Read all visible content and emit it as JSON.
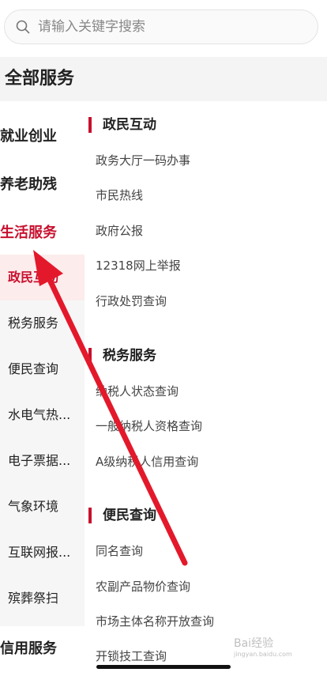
{
  "search": {
    "placeholder": "请输入关键字搜索"
  },
  "section_title": "全部服务",
  "categories": [
    {
      "label": "就业创业",
      "active": false
    },
    {
      "label": "养老助残",
      "active": false
    },
    {
      "label": "生活服务",
      "active": true
    },
    {
      "label": "信用服务",
      "active": false
    }
  ],
  "sub_categories": [
    {
      "label": "政民互动",
      "active": true
    },
    {
      "label": "税务服务",
      "active": false
    },
    {
      "label": "便民查询",
      "active": false
    },
    {
      "label": "水电气热...",
      "active": false
    },
    {
      "label": "电子票据...",
      "active": false
    },
    {
      "label": "气象环境",
      "active": false
    },
    {
      "label": "互联网报...",
      "active": false
    },
    {
      "label": "殡葬祭扫",
      "active": false
    }
  ],
  "groups": [
    {
      "title": "政民互动",
      "items": [
        "政务大厅一码办事",
        "市民热线",
        "政府公报",
        "12318网上举报",
        "行政处罚查询"
      ]
    },
    {
      "title": "税务服务",
      "items": [
        "纳税人状态查询",
        "一般纳税人资格查询",
        "A级纳税人信用查询"
      ]
    },
    {
      "title": "便民查询",
      "items": [
        "同名查询",
        "农副产品物价查询",
        "市场主体名称开放查询",
        "开锁技工查询"
      ]
    }
  ],
  "watermark": {
    "main": "Bai经验",
    "sub": "jingyan.baidu.com"
  },
  "colors": {
    "accent": "#c8102e",
    "arrow": "#e3192b"
  },
  "icons": {
    "search": "magnifier-icon"
  }
}
